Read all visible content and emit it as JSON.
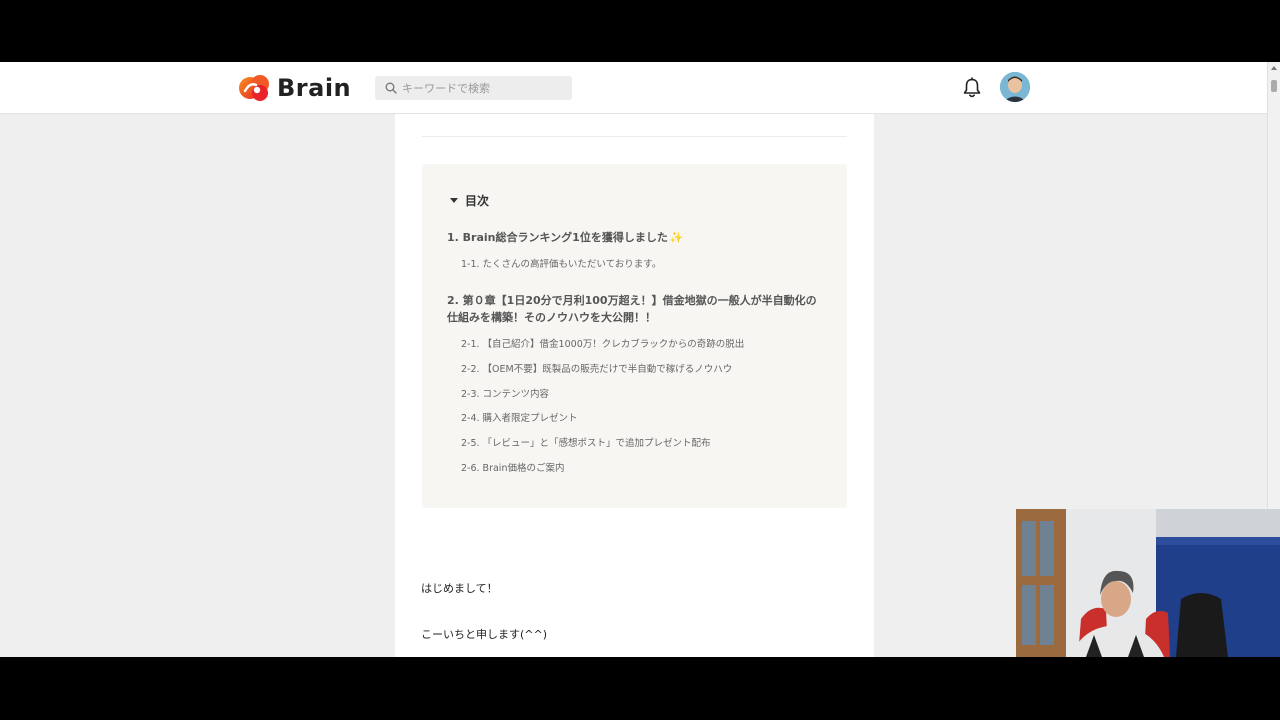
{
  "header": {
    "brand": "Brain",
    "search_placeholder": "キーワードで検索"
  },
  "toc": {
    "title": "目次",
    "items": [
      {
        "level": 1,
        "label": "1. Brain総合ランキング1位を獲得しました",
        "sparkle": "✨"
      },
      {
        "level": 2,
        "label": "1-1. たくさんの高評価もいただいております。"
      },
      {
        "level": 1,
        "label": "2. 第０章【1日20分で月利100万超え！】借金地獄の一般人が半自動化の仕組みを構築！そのノウハウを大公開！！"
      },
      {
        "level": 2,
        "label": "2-1. 【自己紹介】借金1000万！クレカブラックからの奇跡の脱出"
      },
      {
        "level": 2,
        "label": "2-2. 【OEM不要】既製品の販売だけで半自動で稼げるノウハウ"
      },
      {
        "level": 2,
        "label": "2-3. コンテンツ内容"
      },
      {
        "level": 2,
        "label": "2-4. 購入者限定プレゼント"
      },
      {
        "level": 2,
        "label": "2-5. 「レビュー」と「感想ポスト」で追加プレゼント配布"
      },
      {
        "level": 2,
        "label": "2-6. Brain価格のご案内"
      }
    ]
  },
  "body": {
    "p1": "はじめまして！",
    "p2": "こーいちと申します(^^)"
  },
  "colors": {
    "brand_orange": "#f15a24",
    "brand_red": "#e8232a",
    "toc_bg": "#f7f6f3",
    "page_bg": "#efefef"
  }
}
